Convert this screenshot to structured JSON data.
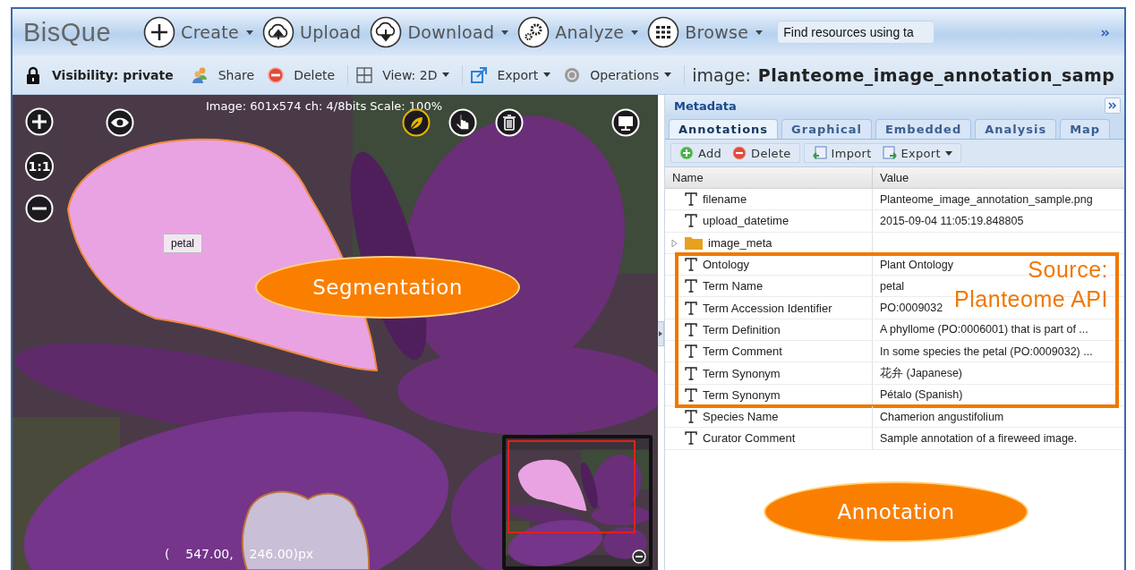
{
  "app": {
    "logo": "BisQue"
  },
  "nav": [
    {
      "kind": "create",
      "label": "Create",
      "dropdown": true
    },
    {
      "kind": "upload",
      "label": "Upload",
      "dropdown": false
    },
    {
      "kind": "download",
      "label": "Download",
      "dropdown": true
    },
    {
      "kind": "analyze",
      "label": "Analyze",
      "dropdown": true
    },
    {
      "kind": "browse",
      "label": "Browse",
      "dropdown": true
    }
  ],
  "search": {
    "placeholder": "Find resources using ta"
  },
  "toolbar": {
    "items": [
      {
        "kind": "lock",
        "label": "Visibility: private",
        "dropdown": false
      },
      {
        "kind": "share",
        "label": "Share",
        "dropdown": false
      },
      {
        "kind": "delete",
        "label": "Delete",
        "dropdown": false
      },
      {
        "kind": "view",
        "label": "View: 2D",
        "dropdown": true
      },
      {
        "kind": "export",
        "label": "Export",
        "dropdown": true
      },
      {
        "kind": "operations",
        "label": "Operations",
        "dropdown": true
      }
    ],
    "title_prefix": "image:",
    "title": "Planteome_image_annotation_samp"
  },
  "viewer": {
    "info": "Image: 601x574 ch: 4/8bits Scale: 100%",
    "zoom_reset": "1:1",
    "segment_label": "petal",
    "coordinates": "(    547.00,    246.00)px",
    "callout": "Segmentation",
    "tools": [
      {
        "kind": "leaf",
        "selected": true
      },
      {
        "kind": "pointer",
        "selected": false
      },
      {
        "kind": "trash",
        "selected": false
      }
    ]
  },
  "metadata": {
    "title": "Metadata",
    "tabs": [
      {
        "label": "Annotations",
        "selected": true
      },
      {
        "label": "Graphical",
        "selected": false
      },
      {
        "label": "Embedded",
        "selected": false
      },
      {
        "label": "Analysis",
        "selected": false
      },
      {
        "label": "Map",
        "selected": false
      }
    ],
    "actions": [
      {
        "kind": "add",
        "label": "Add",
        "dropdown": false
      },
      {
        "kind": "delete",
        "label": "Delete",
        "dropdown": false
      },
      {
        "kind": "import",
        "label": "Import",
        "dropdown": false
      },
      {
        "kind": "export",
        "label": "Export",
        "dropdown": true
      }
    ],
    "columns": [
      "Name",
      "Value"
    ],
    "row_groups": [
      {
        "kind": "plain",
        "rows": [
          {
            "kind": "text",
            "name": "filename",
            "value": "Planteome_image_annotation_sample.png"
          },
          {
            "kind": "text",
            "name": "upload_datetime",
            "value": "2015-09-04 11:05:19.848805"
          },
          {
            "kind": "folder",
            "name": "image_meta",
            "expanded": false
          }
        ]
      },
      {
        "kind": "source",
        "label_lines": [
          "Source:",
          "Planteome API"
        ],
        "rows": [
          {
            "kind": "text",
            "name": "Ontology",
            "value": "Plant Ontology"
          },
          {
            "kind": "text",
            "name": "Term Name",
            "value": "petal"
          },
          {
            "kind": "text",
            "name": "Term Accession Identifier",
            "value": "PO:0009032"
          },
          {
            "kind": "text",
            "name": "Term Definition",
            "value": "A phyllome (PO:0006001) that is part of ..."
          },
          {
            "kind": "text",
            "name": "Term Comment",
            "value": "In some species the petal (PO:0009032) ..."
          },
          {
            "kind": "text",
            "name": "Term Synonym",
            "value": "花弁 (Japanese)"
          },
          {
            "kind": "text",
            "name": "Term Synonym",
            "value": "Pétalo (Spanish)"
          }
        ]
      },
      {
        "kind": "plain",
        "rows": [
          {
            "kind": "text",
            "name": "Species Name",
            "value": "Chamerion angustifolium"
          },
          {
            "kind": "text",
            "name": "Curator Comment",
            "value": "Sample annotation of a fireweed image."
          }
        ]
      }
    ],
    "callout": "Annotation"
  }
}
